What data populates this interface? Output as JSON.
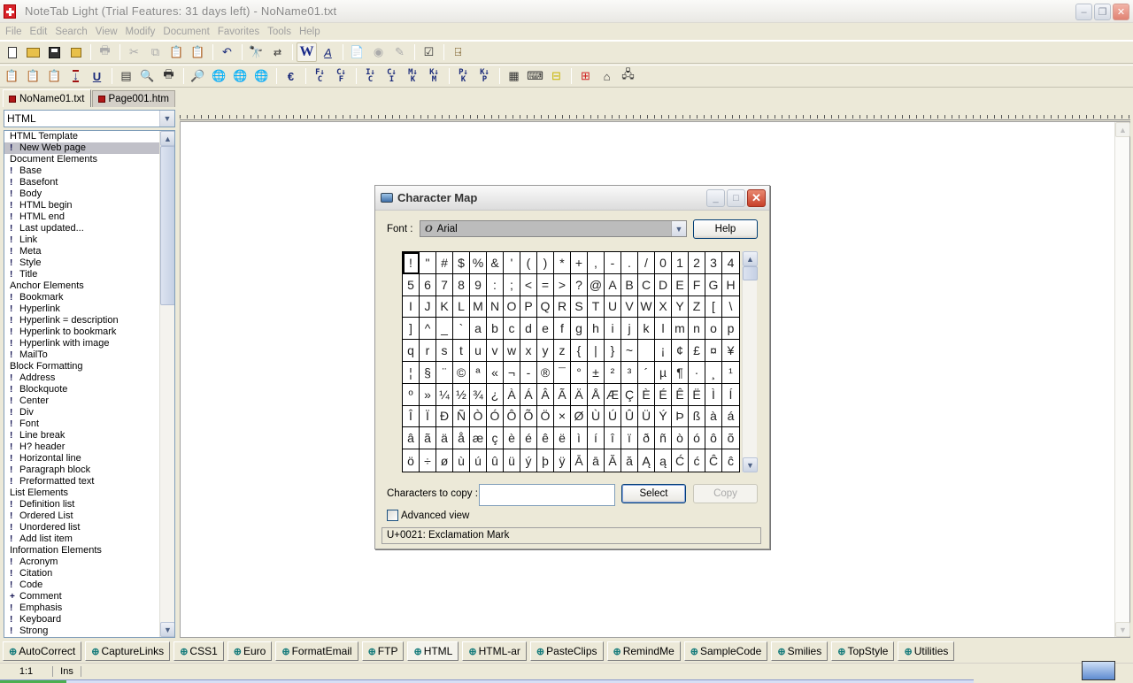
{
  "window": {
    "title": "NoteTab Light (Trial Features: 31 days left)  -  NoName01.txt",
    "controls": [
      "minimize",
      "restore",
      "close"
    ]
  },
  "menu": [
    "File",
    "Edit",
    "Search",
    "View",
    "Modify",
    "Document",
    "Favorites",
    "Tools",
    "Help"
  ],
  "toolbar1": [
    {
      "name": "new-document-icon"
    },
    {
      "name": "open-folder-icon"
    },
    {
      "name": "save-icon"
    },
    {
      "name": "save-all-icon"
    },
    {
      "name": "print-icon",
      "disabled": true
    },
    {
      "name": "cut-icon",
      "disabled": true
    },
    {
      "name": "copy-icon",
      "disabled": true
    },
    {
      "name": "paste-icon",
      "disabled": true
    },
    {
      "name": "paste-special-icon",
      "disabled": true
    },
    {
      "name": "undo-icon"
    },
    {
      "name": "find-icon"
    },
    {
      "name": "replace-icon"
    },
    {
      "name": "word-wrap-icon",
      "pressed": true
    },
    {
      "name": "font-icon"
    },
    {
      "name": "clipboard-icon"
    },
    {
      "name": "spellcheck-icon",
      "disabled": true
    },
    {
      "name": "thesaurus-icon",
      "disabled": true
    },
    {
      "name": "outline-icon"
    },
    {
      "name": "exit-icon"
    }
  ],
  "toolbar2": {
    "convert_buttons": [
      {
        "top": "F",
        "bottom": "C"
      },
      {
        "top": "C",
        "bottom": "F"
      },
      {
        "top": "I",
        "bottom": "C"
      },
      {
        "top": "C",
        "bottom": "I"
      },
      {
        "top": "M",
        "bottom": "K"
      },
      {
        "top": "K",
        "bottom": "M"
      },
      {
        "top": "P",
        "bottom": "K"
      },
      {
        "top": "K",
        "bottom": "P"
      }
    ]
  },
  "doc_tabs": [
    {
      "label": "NoName01.txt",
      "active": true
    },
    {
      "label": "Page001.htm",
      "active": false
    }
  ],
  "clipbook": {
    "selected_library": "HTML",
    "items": [
      {
        "type": "header",
        "label": "HTML Template"
      },
      {
        "type": "item",
        "label": "New Web page",
        "selected": true
      },
      {
        "type": "header",
        "label": "Document Elements"
      },
      {
        "type": "item",
        "label": "Base"
      },
      {
        "type": "item",
        "label": "Basefont"
      },
      {
        "type": "item",
        "label": "Body"
      },
      {
        "type": "item",
        "label": "HTML begin"
      },
      {
        "type": "item",
        "label": "HTML end"
      },
      {
        "type": "item",
        "label": "Last updated..."
      },
      {
        "type": "item",
        "label": "Link"
      },
      {
        "type": "item",
        "label": "Meta"
      },
      {
        "type": "item",
        "label": "Style"
      },
      {
        "type": "item",
        "label": "Title"
      },
      {
        "type": "header",
        "label": "Anchor Elements"
      },
      {
        "type": "item",
        "label": "Bookmark"
      },
      {
        "type": "item",
        "label": "Hyperlink"
      },
      {
        "type": "item",
        "label": "Hyperlink = description"
      },
      {
        "type": "item",
        "label": "Hyperlink to bookmark"
      },
      {
        "type": "item",
        "label": "Hyperlink with image"
      },
      {
        "type": "item",
        "label": "MailTo"
      },
      {
        "type": "header",
        "label": "Block Formatting"
      },
      {
        "type": "item",
        "label": "Address"
      },
      {
        "type": "item",
        "label": "Blockquote"
      },
      {
        "type": "item",
        "label": "Center"
      },
      {
        "type": "item",
        "label": "Div"
      },
      {
        "type": "item",
        "label": "Font"
      },
      {
        "type": "item",
        "label": "Line break"
      },
      {
        "type": "item",
        "label": "H? header"
      },
      {
        "type": "item",
        "label": "Horizontal line"
      },
      {
        "type": "item",
        "label": "Paragraph block"
      },
      {
        "type": "item",
        "label": "Preformatted text"
      },
      {
        "type": "header",
        "label": "List Elements"
      },
      {
        "type": "item",
        "label": "Definition list"
      },
      {
        "type": "item",
        "label": "Ordered List"
      },
      {
        "type": "item",
        "label": "Unordered list"
      },
      {
        "type": "item",
        "label": "Add list item"
      },
      {
        "type": "header",
        "label": "Information Elements"
      },
      {
        "type": "item",
        "label": "Acronym"
      },
      {
        "type": "item",
        "label": "Citation"
      },
      {
        "type": "item",
        "label": "Code"
      },
      {
        "type": "item",
        "label": "Comment",
        "marker": "+"
      },
      {
        "type": "item",
        "label": "Emphasis"
      },
      {
        "type": "item",
        "label": "Keyboard"
      },
      {
        "type": "item",
        "label": "Strong"
      }
    ]
  },
  "charmap": {
    "title": "Character Map",
    "font_label": "Font :",
    "font_value": "Arial",
    "help_label": "Help",
    "characters": [
      "!",
      "\"",
      "#",
      "$",
      "%",
      "&",
      "'",
      "(",
      ")",
      "*",
      "+",
      ",",
      "-",
      ".",
      "/",
      "0",
      "1",
      "2",
      "3",
      "4",
      "5",
      "6",
      "7",
      "8",
      "9",
      ":",
      ";",
      "<",
      "=",
      ">",
      "?",
      "@",
      "A",
      "B",
      "C",
      "D",
      "E",
      "F",
      "G",
      "H",
      "I",
      "J",
      "K",
      "L",
      "M",
      "N",
      "O",
      "P",
      "Q",
      "R",
      "S",
      "T",
      "U",
      "V",
      "W",
      "X",
      "Y",
      "Z",
      "[",
      "\\",
      "]",
      "^",
      "_",
      "`",
      "a",
      "b",
      "c",
      "d",
      "e",
      "f",
      "g",
      "h",
      "i",
      "j",
      "k",
      "l",
      "m",
      "n",
      "o",
      "p",
      "q",
      "r",
      "s",
      "t",
      "u",
      "v",
      "w",
      "x",
      "y",
      "z",
      "{",
      "|",
      "}",
      "~",
      " ",
      "¡",
      "¢",
      "£",
      "¤",
      "¥",
      "¦",
      "§",
      "¨",
      "©",
      "ª",
      "«",
      "¬",
      "-",
      "®",
      "¯",
      "°",
      "±",
      "²",
      "³",
      "´",
      "µ",
      "¶",
      "·",
      "¸",
      "¹",
      "º",
      "»",
      "¼",
      "½",
      "¾",
      "¿",
      "À",
      "Á",
      "Â",
      "Ã",
      "Ä",
      "Å",
      "Æ",
      "Ç",
      "È",
      "É",
      "Ê",
      "Ë",
      "Ì",
      "Í",
      "Î",
      "Ï",
      "Ð",
      "Ñ",
      "Ò",
      "Ó",
      "Ô",
      "Õ",
      "Ö",
      "×",
      "Ø",
      "Ù",
      "Ú",
      "Û",
      "Ü",
      "Ý",
      "Þ",
      "ß",
      "à",
      "á",
      "â",
      "ã",
      "ä",
      "å",
      "æ",
      "ç",
      "è",
      "é",
      "ê",
      "ë",
      "ì",
      "í",
      "î",
      "ï",
      "ð",
      "ñ",
      "ò",
      "ó",
      "ô",
      "õ",
      "ö",
      "÷",
      "ø",
      "ù",
      "ú",
      "û",
      "ü",
      "ý",
      "þ",
      "ÿ",
      "Ā",
      "ā",
      "Ă",
      "ă",
      "Ą",
      "ą",
      "Ć",
      "ć",
      "Ĉ",
      "ĉ"
    ],
    "selected_index": 0,
    "copy_label": "Characters to copy :",
    "copy_value": "",
    "select_label": "Select",
    "copy_button_label": "Copy",
    "advanced_label": "Advanced view",
    "advanced_checked": false,
    "status": "U+0021: Exclamation Mark"
  },
  "clipbook_tabs": [
    {
      "label": "AutoCorrect"
    },
    {
      "label": "CaptureLinks"
    },
    {
      "label": "CSS1"
    },
    {
      "label": "Euro"
    },
    {
      "label": "FormatEmail"
    },
    {
      "label": "FTP"
    },
    {
      "label": "HTML",
      "active": true
    },
    {
      "label": "HTML-ar"
    },
    {
      "label": "PasteClips"
    },
    {
      "label": "RemindMe"
    },
    {
      "label": "SampleCode"
    },
    {
      "label": "Smilies"
    },
    {
      "label": "TopStyle"
    },
    {
      "label": "Utilities"
    }
  ],
  "statusbar": {
    "position": "1:1",
    "mode": "Ins"
  }
}
